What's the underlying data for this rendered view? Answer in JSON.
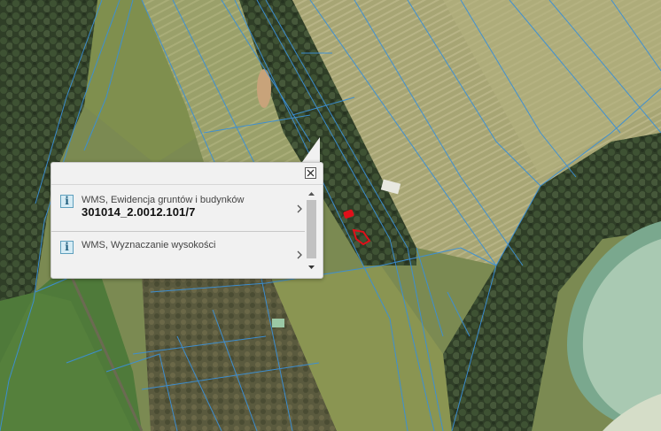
{
  "popup": {
    "results": [
      {
        "icon": "info-icon",
        "layer": "WMS, Ewidencja gruntów i budynków",
        "value": "301014_2.0012.101/7"
      },
      {
        "icon": "info-icon",
        "layer": "WMS, Wyznaczanie wysokości",
        "value": ""
      }
    ],
    "close_icon": "close-icon",
    "info_glyph": "i"
  },
  "map": {
    "parcel_line_color": "#3b8fd6",
    "selected_parcel_color": "#e0101a",
    "water_color": "#8fb8a0"
  }
}
